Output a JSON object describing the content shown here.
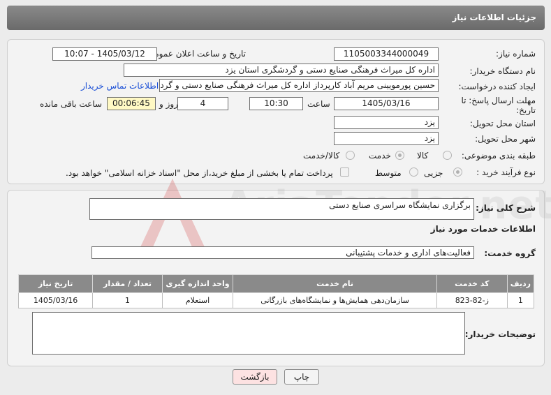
{
  "header": {
    "title": "جزئیات اطلاعات نیاز"
  },
  "form": {
    "need_number_label": "شماره نیاز:",
    "need_number": "1105003344000049",
    "announce_label": "تاریخ و ساعت اعلان عمومی:",
    "announce_value": "1405/03/12 - 10:07",
    "buyer_org_label": "نام دستگاه خریدار:",
    "buyer_org": "اداره کل میراث فرهنگی  صنایع دستی و گردشگری استان یزد",
    "creator_label": "ایجاد کننده درخواست:",
    "creator": "حسین پورمویینی مریم آباد کارپرداز اداره کل میراث فرهنگی  صنایع دستی و گردشگری استان یزد",
    "contact_link": "اطلاعات تماس خریدار",
    "deadline_label": "مهلت ارسال پاسخ: تا تاریخ:",
    "deadline_date": "1405/03/16",
    "time_label": "ساعت",
    "deadline_time": "10:30",
    "days_value": "4",
    "days_label": "روز و",
    "remaining_value": "00:06:45",
    "remaining_label": "ساعت باقی مانده",
    "province_label": "استان محل تحویل:",
    "province": "یزد",
    "city_label": "شهر محل تحویل:",
    "city": "یزد",
    "category_label": "طبقه بندی موضوعی:",
    "category_options": [
      "کالا",
      "خدمت",
      "کالا/خدمت"
    ],
    "category_selected": "خدمت",
    "process_label": "نوع فرآیند خرید :",
    "process_options": [
      "جزیی",
      "متوسط"
    ],
    "process_selected": "جزیی",
    "payment_note": "پرداخت تمام یا بخشی از مبلغ خرید،از محل \"اسناد خزانه اسلامی\" خواهد بود."
  },
  "details": {
    "summary_label": "شرح کلی نیاز:",
    "summary": "برگزاری نمایشگاه سراسری صنایع دستی",
    "services_title": "اطلاعات خدمات مورد نیاز",
    "service_group_label": "گروه خدمت:",
    "service_group": "فعالیت‌های اداری و خدمات پشتیبانی",
    "table": {
      "headers": [
        "ردیف",
        "کد خدمت",
        "نام خدمت",
        "واحد اندازه گیری",
        "تعداد / مقدار",
        "تاریخ نیاز"
      ],
      "rows": [
        [
          "1",
          "ز-82-823",
          "سازمان‌دهی همایش‌ها و نمایشگاه‌های بازرگانی",
          "استعلام",
          "1",
          "1405/03/16"
        ]
      ]
    },
    "buyer_notes_label": "توضیحات خریدار:",
    "buyer_notes": ""
  },
  "buttons": {
    "print": "چاپ",
    "back": "بازگشت"
  },
  "watermark": {
    "text": "AriaTender.net"
  },
  "colors": {
    "header_bg": "#7a7a7a",
    "link": "#1a4fd6",
    "remaining_bg": "#fff9c4",
    "back_bg": "#fde2e2",
    "watermark": "#e0a0a0"
  }
}
